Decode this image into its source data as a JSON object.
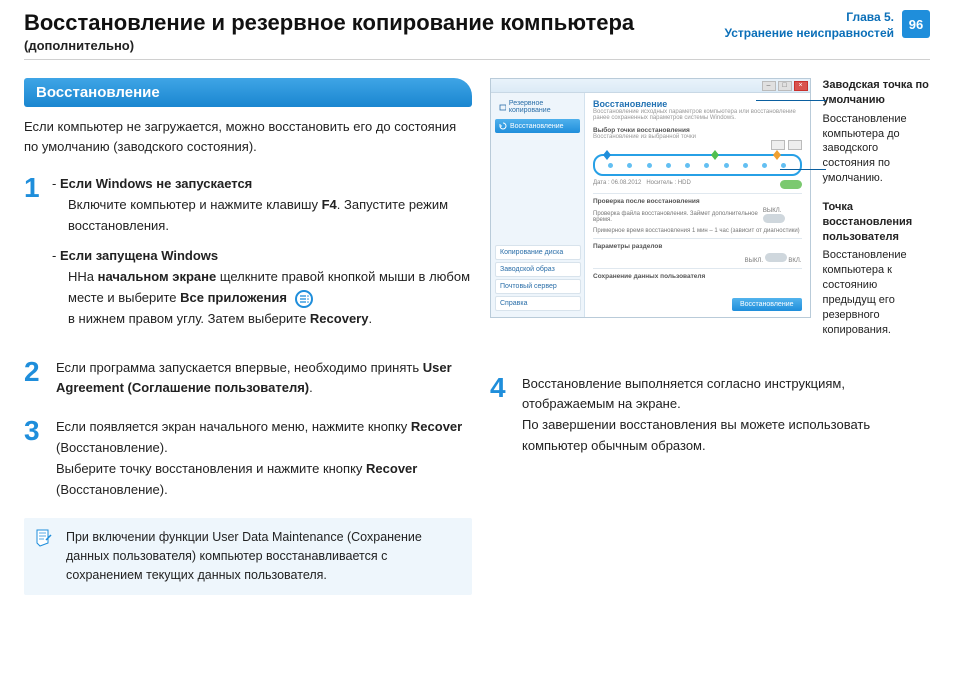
{
  "header": {
    "title": "Восстановление и резервное копирование компьютера",
    "subtitle": "(дополнительно)",
    "chapter_line1": "Глава 5.",
    "chapter_line2": "Устранение неисправностей",
    "page_number": "96"
  },
  "section_title": "Восстановление",
  "intro": "Если компьютер не загружается, можно восстановить его до состояния по умолчанию (заводского состояния).",
  "steps": {
    "s1": {
      "num": "1",
      "a_title": "Если Windows не запускается",
      "a_body_1": "Включите компьютер и нажмите клавишу ",
      "a_key": "F4",
      "a_body_2": ". Запустите режим восстановления.",
      "b_title": "Если запущена Windows",
      "b_body_1a": "ННа ",
      "b_body_1b": "начальном экране",
      "b_body_1c": " щелкните правой кнопкой мыши в любом месте и выберите ",
      "b_body_1d": "Все приложения",
      "b_body_2a": "в нижнем правом углу. Затем выберите ",
      "b_body_2b": "Recovery",
      "b_body_2c": "."
    },
    "s2": {
      "num": "2",
      "body_1": "Если программа запускается впервые, необходимо принять ",
      "body_2": "User Agreement (Соглашение пользователя)",
      "body_3": "."
    },
    "s3": {
      "num": "3",
      "body_1": "Если появляется экран начального меню, нажмите кнопку ",
      "body_2": "Recover",
      "body_3": " (Восстановление).",
      "body_4": "Выберите точку восстановления и нажмите кнопку ",
      "body_5": "Recover",
      "body_6": " (Восстановление)."
    },
    "s4": {
      "num": "4",
      "body_1": "Восстановление выполняется согласно инструкциям, отображаемым на экране.",
      "body_2": "По завершении восстановления вы можете использовать компьютер обычным образом."
    }
  },
  "note": "При включении функции User Data Maintenance (Сохранение данных пользователя) компьютер восстанавливается с сохранением текущих данных пользователя.",
  "mock": {
    "side_item_1": "Резервное копирование",
    "side_item_2": "Восстановление",
    "side_bottom_1": "Копирование диска",
    "side_bottom_2": "Заводской образ",
    "side_bottom_3": "Почтовый сервер",
    "side_bottom_4": "Справка",
    "main_title": "Восстановление",
    "main_sub": "Восстановление исходных параметров компьютера или восстановление ранее сохраненных параметров системы Windows.",
    "sect1": "Выбор точки восстановления",
    "sect1_sub": "Восстановление из выбранной точки",
    "date_label": "Дата :",
    "date_value": "06.08.2012",
    "media_label": "Носитель :",
    "media_value": "HDD",
    "sect2": "Проверка после восстановления",
    "sect2_line1": "Проверка файла восстановления. Займет дополнительное время.",
    "sect2_line2": "Примерное время восстановления 1 мин – 1 час (зависит от диагностики)",
    "toggle_off": "ВЫКЛ.",
    "toggle_on": "ВКЛ.",
    "sect3": "Параметры разделов",
    "sect4": "Сохранение данных пользователя",
    "primary_btn": "Восстановление"
  },
  "callouts": {
    "c1_title": "Заводская точка по умолчанию",
    "c1_body": "Восстановление компьютера до заводского состояния по умолчанию.",
    "c2_title": "Точка восстановления пользователя",
    "c2_body": "Восстановление компьютера к состоянию предыдущ его резервного копирования."
  }
}
